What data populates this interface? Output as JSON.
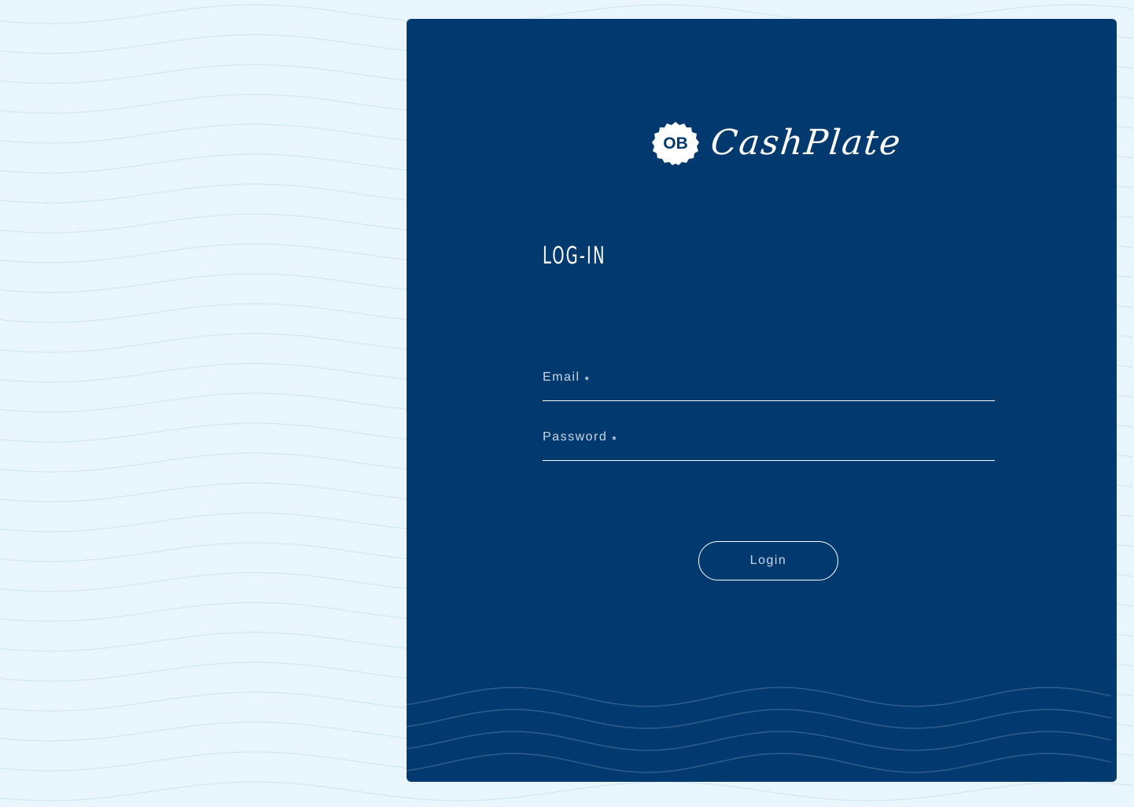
{
  "brand": {
    "logo_text": "OB",
    "name": "CashPlate"
  },
  "login_form": {
    "heading": "LOG-IN",
    "email": {
      "label": "Email",
      "required_mark": "*",
      "value": ""
    },
    "password": {
      "label": "Password",
      "required_mark": "*",
      "value": ""
    },
    "submit_label": "Login"
  },
  "colors": {
    "page_background": "#e9f6fe",
    "card_background": "#02396f",
    "text_primary": "#ffffff",
    "text_muted": "#c9d7e6",
    "wave_light": "#cfe3ef",
    "wave_dark": "#2e5e8e"
  },
  "icons": {
    "logo": "ob-badge-logo"
  }
}
